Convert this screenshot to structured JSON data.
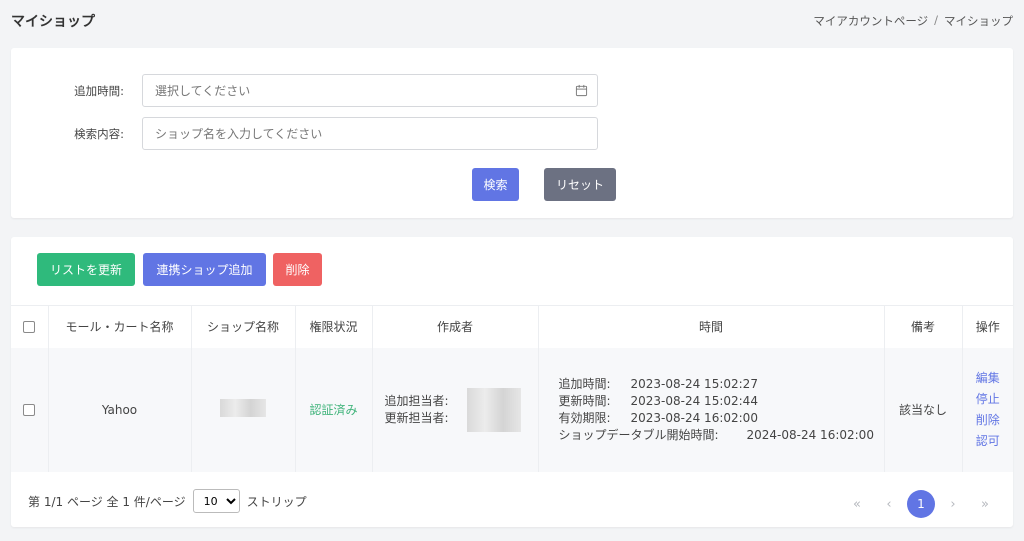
{
  "page": {
    "title": "マイショップ"
  },
  "breadcrumb": {
    "items": [
      "マイアカウントページ",
      "マイショップ"
    ],
    "separator": "/"
  },
  "filter": {
    "added_time_label": "追加時間:",
    "added_time_placeholder": "選択してください",
    "search_label": "検索内容:",
    "search_placeholder": "ショップ名を入力してください",
    "search_button": "検索",
    "reset_button": "リセット"
  },
  "toolbar": {
    "refresh_label": "リストを更新",
    "add_label": "連携ショップ追加",
    "delete_label": "削除"
  },
  "table": {
    "headers": [
      "モール・カート名称",
      "ショップ名称",
      "権限状況",
      "作成者",
      "時間",
      "備考",
      "操作"
    ],
    "rows": [
      {
        "mall": "Yahoo",
        "auth_status": "認証済み",
        "creator_added_label": "追加担当者:",
        "creator_updated_label": "更新担当者:",
        "times": [
          {
            "label": "追加時間:",
            "value": "2023-08-24 15:02:27"
          },
          {
            "label": "更新時間:",
            "value": "2023-08-24 15:02:44"
          },
          {
            "label": "有効期限:",
            "value": "2023-08-24 16:02:00"
          },
          {
            "label": "ショップデータブル開始時間:",
            "value": "2024-08-24 16:02:00"
          }
        ],
        "remarks": "該当なし",
        "actions": [
          "編集",
          "停止",
          "削除",
          "認可"
        ]
      }
    ]
  },
  "pager": {
    "info": "第 1/1 ページ 全 1 件/ページ",
    "page_size": "10",
    "suffix": "ストリップ",
    "current_page": "1",
    "first": "«",
    "prev": "‹",
    "next": "›",
    "last": "»"
  },
  "colors": {
    "primary": "#6175e4",
    "success": "#2fba7c",
    "danger": "#ef6262",
    "secondary": "#6c7182",
    "auth_ok": "#3fb37a"
  }
}
